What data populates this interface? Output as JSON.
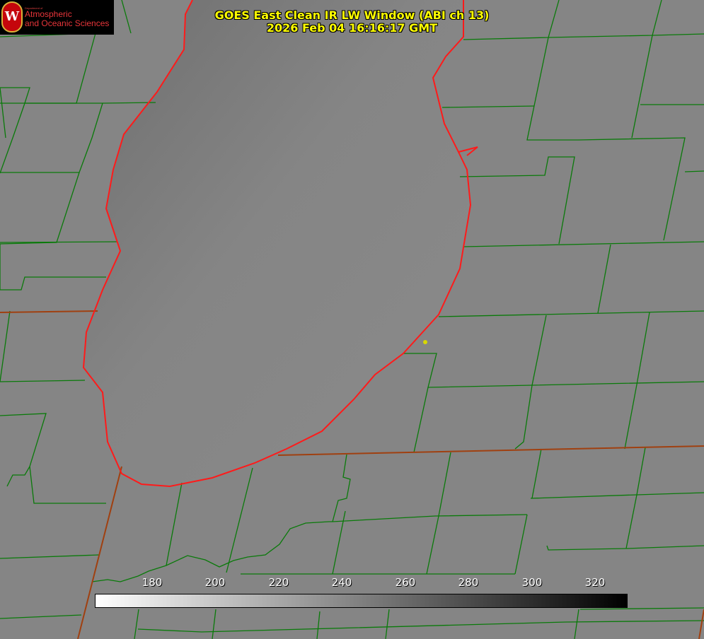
{
  "logo": {
    "initial": "W",
    "dept": "Department of",
    "line1": "Atmospheric",
    "line2": "and Oceanic Sciences"
  },
  "title": {
    "line1": "GOES East Clean IR LW Window (ABI ch 13)",
    "line2": "2026 Feb 04 16:16:17 GMT"
  },
  "colorbar": {
    "ticks": [
      "180",
      "200",
      "220",
      "240",
      "260",
      "280",
      "300",
      "320"
    ],
    "min": 163,
    "max": 330,
    "low_color": "#ffffff",
    "high_color": "#000000"
  },
  "colors": {
    "county_lines": "#0a7a0a",
    "shoreline": "#ff1a1a",
    "state_border": "#a04010",
    "marker": "#d8d800"
  }
}
